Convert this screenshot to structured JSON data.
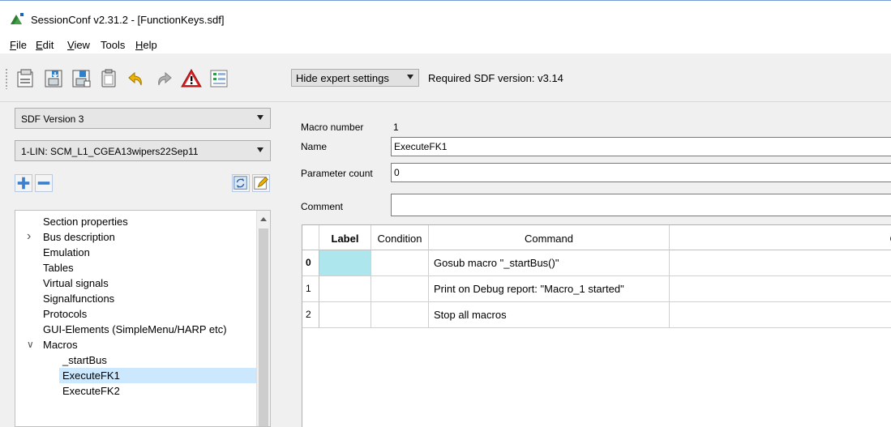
{
  "window": {
    "title": "SessionConf v2.31.2 - [FunctionKeys.sdf]"
  },
  "menu": [
    {
      "label": "File",
      "mnemonic": "F",
      "rest": "ile"
    },
    {
      "label": "Edit",
      "mnemonic": "E",
      "rest": "dit"
    },
    {
      "label": "View",
      "mnemonic": "V",
      "rest": "iew"
    },
    {
      "label": "Tools",
      "mnemonic": "",
      "rest": "Tools"
    },
    {
      "label": "Help",
      "mnemonic": "H",
      "rest": "elp"
    }
  ],
  "toolbar": {
    "icons": [
      "open-icon",
      "save-icon",
      "save-as-icon",
      "clipboard-icon",
      "undo-icon",
      "redo-icon",
      "warning-icon",
      "report-icon"
    ],
    "expert_mode": "Hide expert settings",
    "required_version": "Required SDF version: v3.14",
    "colors": {
      "warning": "#e02020",
      "undo": "#f0b400"
    }
  },
  "left": {
    "sdf_version": "SDF Version 3",
    "bus_select": "1-LIN: SCM_L1_CGEA13wipers22Sep11",
    "tree": [
      {
        "label": "Section properties",
        "level": 0,
        "expander": ""
      },
      {
        "label": "Bus description",
        "level": 0,
        "expander": "collapsed"
      },
      {
        "label": "Emulation",
        "level": 0,
        "expander": ""
      },
      {
        "label": "Tables",
        "level": 0,
        "expander": ""
      },
      {
        "label": "Virtual signals",
        "level": 0,
        "expander": ""
      },
      {
        "label": "Signalfunctions",
        "level": 0,
        "expander": ""
      },
      {
        "label": "Protocols",
        "level": 0,
        "expander": ""
      },
      {
        "label": "GUI-Elements (SimpleMenu/HARP etc)",
        "level": 0,
        "expander": ""
      },
      {
        "label": "Macros",
        "level": 0,
        "expander": "expanded"
      },
      {
        "label": "_startBus",
        "level": 1,
        "expander": ""
      },
      {
        "label": "ExecuteFK1",
        "level": 1,
        "expander": "",
        "selected": true
      },
      {
        "label": "ExecuteFK2",
        "level": 1,
        "expander": ""
      }
    ]
  },
  "form": {
    "macro_number_label": "Macro number",
    "macro_number": "1",
    "name_label": "Name",
    "name": "ExecuteFK1",
    "param_count_label": "Parameter count",
    "param_count": "0",
    "comment_label": "Comment",
    "comment": ""
  },
  "grid": {
    "columns": [
      "Label",
      "Condition",
      "Command",
      "Com"
    ],
    "rows": [
      {
        "num": "0",
        "label": "",
        "condition": "",
        "command": "Gosub macro \"_startBus()\"",
        "comment": ""
      },
      {
        "num": "1",
        "label": "",
        "condition": "",
        "command": "Print on Debug report: \"Macro_1 started\"",
        "comment": ""
      },
      {
        "num": "2",
        "label": "",
        "condition": "",
        "command": "Stop all macros",
        "comment": ""
      }
    ]
  }
}
